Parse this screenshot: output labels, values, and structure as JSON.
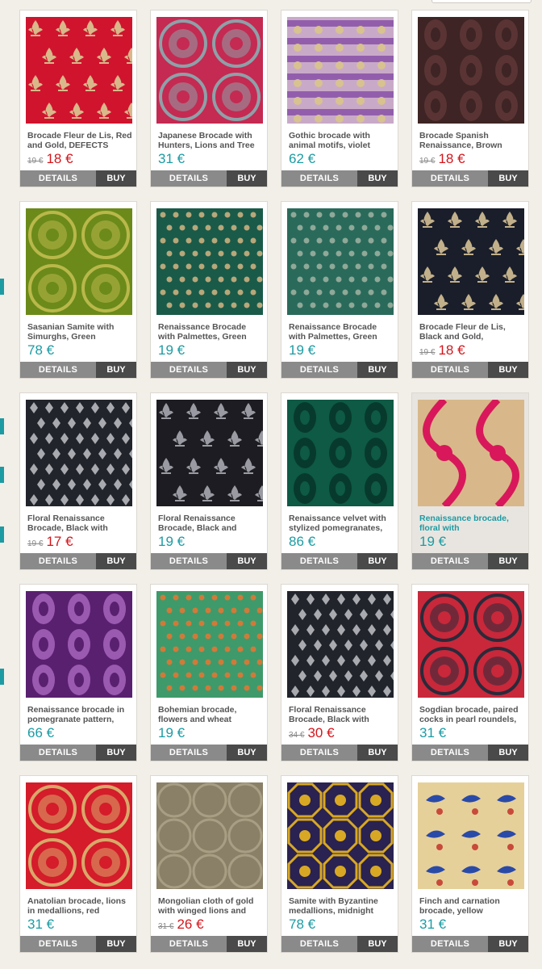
{
  "currency": "€",
  "buttons": {
    "details": "DETAILS",
    "buy": "BUY"
  },
  "colors": {
    "accent": "#1c9ba3",
    "sale": "#d4161c",
    "details_btn": "#8a8a8a",
    "buy_btn": "#4a4a4a",
    "background": "#f2efe9"
  },
  "products": [
    {
      "name": "Brocade Fleur de Lis, Red and Gold, DEFECTS",
      "old_price": "19 €",
      "price": "18 €",
      "on_sale": true,
      "pattern": "fleur",
      "bg": "#d0142e",
      "fg": "#d9b88a"
    },
    {
      "name": "Japanese Brocade with Hunters, Lions and Tree",
      "old_price": "",
      "price": "31 €",
      "on_sale": false,
      "pattern": "roundel",
      "bg": "#c42a52",
      "fg": "#8ea0a8"
    },
    {
      "name": "Gothic brocade with animal motifs, violet",
      "old_price": "",
      "price": "62 €",
      "on_sale": false,
      "pattern": "stripe",
      "bg": "#c9a9c8",
      "fg": "#7a3fa0"
    },
    {
      "name": "Brocade Spanish Renaissance, Brown",
      "old_price": "19 €",
      "price": "18 €",
      "on_sale": true,
      "pattern": "damask",
      "bg": "#3e2424",
      "fg": "#5a3434"
    },
    {
      "name": "Sasanian Samite with Simurghs, Green",
      "old_price": "",
      "price": "78 €",
      "on_sale": false,
      "pattern": "roundel",
      "bg": "#6b8a1a",
      "fg": "#b9b84a"
    },
    {
      "name": "Renaissance Brocade with Palmettes, Green",
      "old_price": "",
      "price": "19 €",
      "on_sale": false,
      "pattern": "dots",
      "bg": "#1a5a48",
      "fg": "#b7a77a"
    },
    {
      "name": "Renaissance Brocade with Palmettes, Green",
      "old_price": "",
      "price": "19 €",
      "on_sale": false,
      "pattern": "dots",
      "bg": "#2a6a5a",
      "fg": "#8fa898"
    },
    {
      "name": "Brocade Fleur de Lis, Black and Gold,",
      "old_price": "19 €",
      "price": "18 €",
      "on_sale": true,
      "pattern": "fleur",
      "bg": "#1a1e2a",
      "fg": "#c2b08a"
    },
    {
      "name": "Floral Renaissance Brocade, Black with",
      "old_price": "19 €",
      "price": "17 €",
      "on_sale": true,
      "pattern": "lattice",
      "bg": "#22242c",
      "fg": "#a8aab0"
    },
    {
      "name": "Floral Renaissance Brocade, Black and",
      "old_price": "",
      "price": "19 €",
      "on_sale": false,
      "pattern": "fleur",
      "bg": "#1c1c22",
      "fg": "#9a9aa2"
    },
    {
      "name": "Renaissance velvet with stylized pomegranates,",
      "old_price": "",
      "price": "86 €",
      "on_sale": false,
      "pattern": "damask",
      "bg": "#0e5a44",
      "fg": "#073a2c"
    },
    {
      "name": "Renaissance brocade, floral with",
      "old_price": "",
      "price": "19 €",
      "on_sale": false,
      "pattern": "ogee",
      "bg": "#d8b88a",
      "fg": "#d8185a",
      "hover": true
    },
    {
      "name": "Renaissance brocade in pomegranate pattern,",
      "old_price": "",
      "price": "66 €",
      "on_sale": false,
      "pattern": "damask",
      "bg": "#5a2070",
      "fg": "#9a5ab0"
    },
    {
      "name": "Bohemian brocade, flowers and wheat",
      "old_price": "",
      "price": "19 €",
      "on_sale": false,
      "pattern": "dots",
      "bg": "#3e9a6a",
      "fg": "#d07a3a"
    },
    {
      "name": "Floral Renaissance Brocade, Black with",
      "old_price": "34 €",
      "price": "30 €",
      "on_sale": true,
      "pattern": "lattice",
      "bg": "#22242c",
      "fg": "#a8aab0"
    },
    {
      "name": "Sogdian brocade, paired cocks in pearl roundels,",
      "old_price": "",
      "price": "31 €",
      "on_sale": false,
      "pattern": "roundel",
      "bg": "#c8283a",
      "fg": "#2a2a3a"
    },
    {
      "name": "Anatolian brocade, lions in medallions, red",
      "old_price": "",
      "price": "31 €",
      "on_sale": false,
      "pattern": "roundel",
      "bg": "#d41c2a",
      "fg": "#d8a86a"
    },
    {
      "name": "Mongolian cloth of gold with winged lions and",
      "old_price": "31 €",
      "price": "26 €",
      "on_sale": true,
      "pattern": "circles",
      "bg": "#8a8068",
      "fg": "#a89e84"
    },
    {
      "name": "Samite with Byzantine medallions, midnight",
      "old_price": "",
      "price": "78 €",
      "on_sale": false,
      "pattern": "octagon",
      "bg": "#2a2250",
      "fg": "#d8a824"
    },
    {
      "name": "Finch and carnation brocade, yellow",
      "old_price": "",
      "price": "31 €",
      "on_sale": false,
      "pattern": "birds",
      "bg": "#e6d09a",
      "fg": "#2a4aa8"
    }
  ]
}
